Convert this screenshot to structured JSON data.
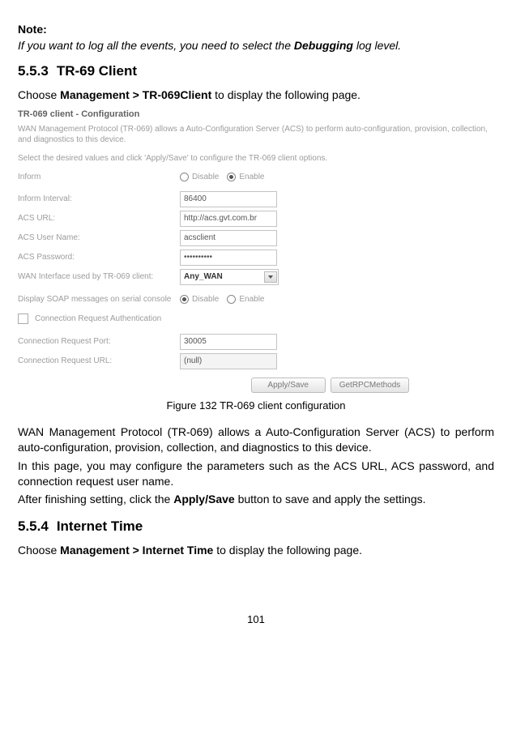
{
  "note": {
    "label": "Note:",
    "text_before": "If you want to log all the events, you need to select the ",
    "bold": "Debugging",
    "text_after": " log level."
  },
  "section553": {
    "num": "5.5.3",
    "title": "TR-69 Client",
    "intro_before": "Choose ",
    "intro_bold": "Management > TR-069Client",
    "intro_after": " to display the following page."
  },
  "shot": {
    "title": "TR-069 client - Configuration",
    "desc": "WAN Management Protocol (TR-069) allows a Auto-Configuration Server (ACS) to perform auto-configuration, provision, collection, and diagnostics to this device.",
    "instr": "Select the desired values and click 'Apply/Save' to configure the TR-069 client options.",
    "inform_label": "Inform",
    "radio_disable": "Disable",
    "radio_enable": "Enable",
    "rows": {
      "interval_label": "Inform Interval:",
      "interval_value": "86400",
      "acs_url_label": "ACS URL:",
      "acs_url_value": "http://acs.gvt.com.br",
      "acs_user_label": "ACS User Name:",
      "acs_user_value": "acsclient",
      "acs_pass_label": "ACS Password:",
      "acs_pass_value": "••••••••••",
      "wan_if_label": "WAN Interface used by TR-069 client:",
      "wan_if_value": "Any_WAN"
    },
    "soap_label": "Display SOAP messages on serial console",
    "soap_disable": "Disable",
    "soap_enable": "Enable",
    "conn_auth": "Connection Request Authentication",
    "conn_port_label": "Connection Request Port:",
    "conn_port_value": "30005",
    "conn_url_label": "Connection Request URL:",
    "conn_url_value": "(null)",
    "btn_apply": "Apply/Save",
    "btn_rpc": "GetRPCMethods"
  },
  "caption": "Figure 132 TR-069 client configuration",
  "para1": "WAN Management Protocol (TR-069) allows a Auto-Configuration Server (ACS) to perform auto-configuration, provision, collection, and diagnostics to this device.",
  "para2": "In this page, you may configure the parameters such as the ACS URL, ACS password, and connection request user name.",
  "para3_before": "After finishing setting, click the ",
  "para3_bold": "Apply/Save",
  "para3_after": " button to save and apply the settings.",
  "section554": {
    "num": "5.5.4",
    "title": "Internet Time",
    "intro_before": "Choose ",
    "intro_bold": "Management > Internet Time",
    "intro_after": " to display the following page."
  },
  "page_number": "101"
}
